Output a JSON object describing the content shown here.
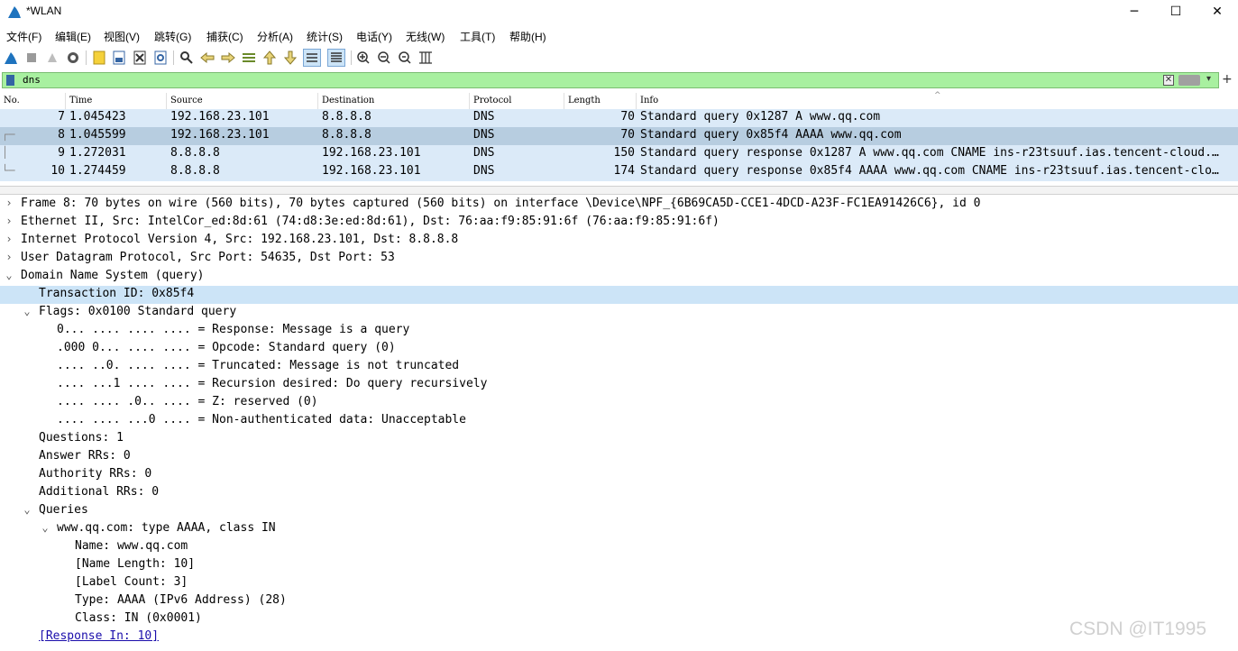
{
  "window": {
    "title": "*WLAN",
    "minimize": "─",
    "maximize": "☐",
    "close": "✕"
  },
  "menu": [
    "文件(F)",
    "编辑(E)",
    "视图(V)",
    "跳转(G)",
    "捕获(C)",
    "分析(A)",
    "统计(S)",
    "电话(Y)",
    "无线(W)",
    "工具(T)",
    "帮助(H)"
  ],
  "toolbar": {
    "icons": [
      "shark-fin-start-icon",
      "stop-icon",
      "restart-icon",
      "capture-options-icon",
      "open-file-icon",
      "save-file-icon",
      "close-file-icon",
      "reload-icon",
      "find-icon",
      "go-back-icon",
      "go-forward-icon",
      "go-to-packet-icon",
      "first-packet-icon",
      "last-packet-icon",
      "auto-scroll-icon",
      "colorize-icon",
      "zoom-in-icon",
      "zoom-out-icon",
      "normal-size-icon",
      "resize-columns-icon"
    ]
  },
  "filter": {
    "value": "dns",
    "clear": "✕",
    "dropdown": "▾",
    "add": "+"
  },
  "columns": [
    "No.",
    "Time",
    "Source",
    "Destination",
    "Protocol",
    "Length",
    "Info"
  ],
  "packets": [
    {
      "no": "7",
      "time": "1.045423",
      "src": "192.168.23.101",
      "dst": "8.8.8.8",
      "proto": "DNS",
      "len": "70",
      "info": "Standard query 0x1287 A www.qq.com",
      "mark": ""
    },
    {
      "no": "8",
      "time": "1.045599",
      "src": "192.168.23.101",
      "dst": "8.8.8.8",
      "proto": "DNS",
      "len": "70",
      "info": "Standard query 0x85f4 AAAA www.qq.com",
      "mark": "┌─"
    },
    {
      "no": "9",
      "time": "1.272031",
      "src": "8.8.8.8",
      "dst": "192.168.23.101",
      "proto": "DNS",
      "len": "150",
      "info": "Standard query response 0x1287 A www.qq.com CNAME ins-r23tsuuf.ias.tencent-cloud.…",
      "mark": "│"
    },
    {
      "no": "10",
      "time": "1.274459",
      "src": "8.8.8.8",
      "dst": "192.168.23.101",
      "proto": "DNS",
      "len": "174",
      "info": "Standard query response 0x85f4 AAAA www.qq.com CNAME ins-r23tsuuf.ias.tencent-clo…",
      "mark": "└─"
    }
  ],
  "details": [
    {
      "arrow": "›",
      "text": "Frame 8: 70 bytes on wire (560 bits), 70 bytes captured (560 bits) on interface \\Device\\NPF_{6B69CA5D-CCE1-4DCD-A23F-FC1EA91426C6}, id 0"
    },
    {
      "arrow": "›",
      "text": "Ethernet II, Src: IntelCor_ed:8d:61 (74:d8:3e:ed:8d:61), Dst: 76:aa:f9:85:91:6f (76:aa:f9:85:91:6f)"
    },
    {
      "arrow": "›",
      "text": "Internet Protocol Version 4, Src: 192.168.23.101, Dst: 8.8.8.8"
    },
    {
      "arrow": "›",
      "text": "User Datagram Protocol, Src Port: 54635, Dst Port: 53"
    },
    {
      "arrow": "⌄",
      "text": "Domain Name System (query)"
    },
    {
      "arrow": "",
      "text": "Transaction ID: 0x85f4"
    },
    {
      "arrow": "⌄",
      "text": "Flags: 0x0100 Standard query"
    },
    {
      "arrow": "",
      "text": "0... .... .... .... = Response: Message is a query"
    },
    {
      "arrow": "",
      "text": ".000 0... .... .... = Opcode: Standard query (0)"
    },
    {
      "arrow": "",
      "text": ".... ..0. .... .... = Truncated: Message is not truncated"
    },
    {
      "arrow": "",
      "text": ".... ...1 .... .... = Recursion desired: Do query recursively"
    },
    {
      "arrow": "",
      "text": ".... .... .0.. .... = Z: reserved (0)"
    },
    {
      "arrow": "",
      "text": ".... .... ...0 .... = Non-authenticated data: Unacceptable"
    },
    {
      "arrow": "",
      "text": "Questions: 1"
    },
    {
      "arrow": "",
      "text": "Answer RRs: 0"
    },
    {
      "arrow": "",
      "text": "Authority RRs: 0"
    },
    {
      "arrow": "",
      "text": "Additional RRs: 0"
    },
    {
      "arrow": "⌄",
      "text": "Queries"
    },
    {
      "arrow": "⌄",
      "text": "www.qq.com: type AAAA, class IN"
    },
    {
      "arrow": "",
      "text": "Name: www.qq.com"
    },
    {
      "arrow": "",
      "text": "[Name Length: 10]"
    },
    {
      "arrow": "",
      "text": "[Label Count: 3]"
    },
    {
      "arrow": "",
      "text": "Type: AAAA (IPv6 Address) (28)"
    },
    {
      "arrow": "",
      "text": "Class: IN (0x0001)"
    },
    {
      "arrow": "",
      "text": "[Response In: 10]"
    }
  ],
  "watermark": "CSDN @IT1995",
  "colors": {
    "filter_bg": "#a8f0a0",
    "row_light": "#dbeaf8",
    "row_selected": "#b7cde0",
    "detail_highlight": "#cce4f7"
  }
}
